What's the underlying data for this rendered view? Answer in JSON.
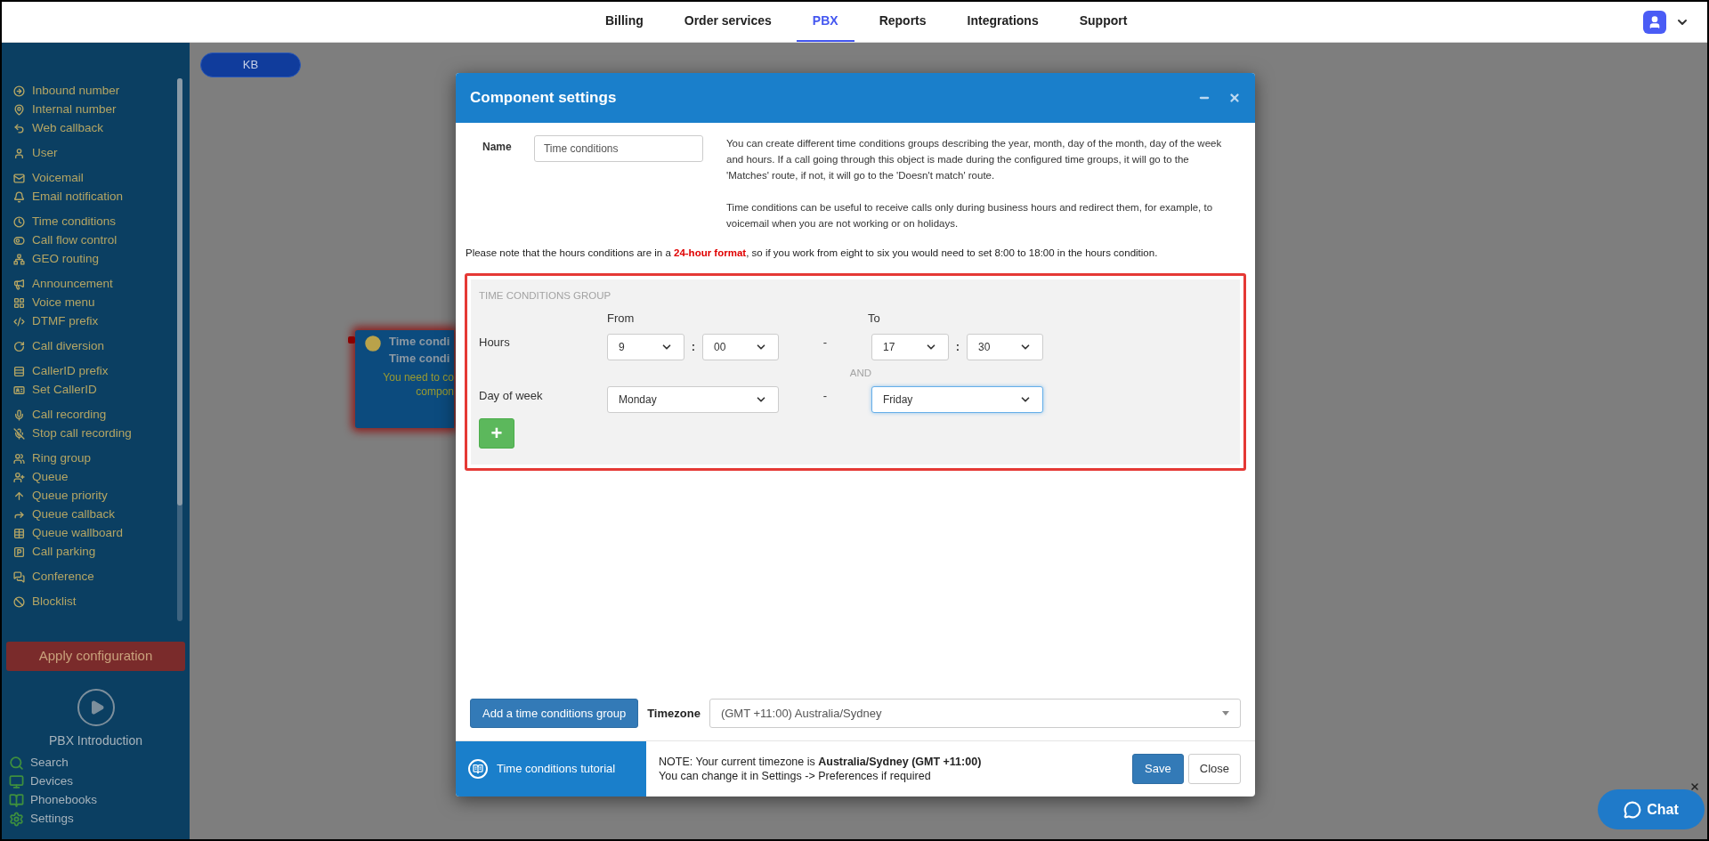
{
  "nav": {
    "tabs": [
      {
        "label": "Billing",
        "selected": false
      },
      {
        "label": "Order services",
        "selected": false
      },
      {
        "label": "PBX",
        "selected": true
      },
      {
        "label": "Reports",
        "selected": false
      },
      {
        "label": "Integrations",
        "selected": false
      },
      {
        "label": "Support",
        "selected": false
      }
    ]
  },
  "sidebar": {
    "groups": [
      {
        "items": [
          {
            "label": "Inbound number"
          },
          {
            "label": "Internal number"
          },
          {
            "label": "Web callback"
          }
        ]
      },
      {
        "items": [
          {
            "label": "User"
          }
        ]
      },
      {
        "items": [
          {
            "label": "Voicemail"
          },
          {
            "label": "Email notification"
          }
        ]
      },
      {
        "items": [
          {
            "label": "Time conditions"
          },
          {
            "label": "Call flow control"
          },
          {
            "label": "GEO routing"
          }
        ]
      },
      {
        "items": [
          {
            "label": "Announcement"
          },
          {
            "label": "Voice menu"
          },
          {
            "label": "DTMF prefix"
          }
        ]
      },
      {
        "items": [
          {
            "label": "Call diversion"
          }
        ]
      },
      {
        "items": [
          {
            "label": "CallerID prefix"
          },
          {
            "label": "Set CallerID"
          }
        ]
      },
      {
        "items": [
          {
            "label": "Call recording"
          },
          {
            "label": "Stop call recording"
          }
        ]
      },
      {
        "items": [
          {
            "label": "Ring group"
          },
          {
            "label": "Queue"
          },
          {
            "label": "Queue priority"
          },
          {
            "label": "Queue callback"
          },
          {
            "label": "Queue wallboard"
          },
          {
            "label": "Call parking"
          }
        ]
      },
      {
        "items": [
          {
            "label": "Conference"
          }
        ]
      },
      {
        "items": [
          {
            "label": "Blocklist"
          }
        ]
      }
    ],
    "apply_button": "Apply configuration",
    "intro_label": "PBX Introduction",
    "tools": [
      {
        "label": "Search"
      },
      {
        "label": "Devices"
      },
      {
        "label": "Phonebooks"
      },
      {
        "label": "Settings"
      }
    ]
  },
  "canvas": {
    "kb_label": "KB",
    "node": {
      "title_lines": [
        "Time condi",
        "Time condi"
      ],
      "message_lines": [
        "You need to co",
        "compon"
      ]
    }
  },
  "modal": {
    "title": "Component settings",
    "name_label": "Name",
    "name_value": "Time conditions",
    "description": [
      "You can create different time conditions groups describing the year, month, day of the month, day of the week and hours. If a call going through this object is made during the configured time groups, it will go to the 'Matches' route, if not, it will go to the 'Doesn't match' route.",
      "Time conditions can be useful to receive calls only during business hours and redirect them, for example, to voicemail when you are not working or on holidays."
    ],
    "note": "Please note that the hours conditions are in a **24-hour format**, so if you work from eight to six you would need to set 8:00 to 18:00 in the hours condition.",
    "group": {
      "heading": "TIME CONDITIONS GROUP",
      "from_label": "From",
      "to_label": "To",
      "hours_label": "Hours",
      "from_hour": {
        "value": "9",
        "focused": false
      },
      "from_minute": {
        "value": "00",
        "focused": false
      },
      "separator": ":",
      "dash": "-",
      "to_hour": {
        "value": "17",
        "focused": false
      },
      "to_minute": {
        "value": "30",
        "focused": false
      },
      "and_label": "AND",
      "day_label": "Day of week",
      "from_day": {
        "value": "Monday",
        "focused": false
      },
      "to_day": {
        "value": "Friday",
        "focused": true
      },
      "add_button": "+"
    },
    "add_group_button": "Add a time conditions group",
    "timezone_label": "Timezone",
    "timezone_value": "(GMT +11:00) Australia/Sydney",
    "tutorial_label": "Time conditions tutorial",
    "footer_note": [
      "NOTE: Your current timezone is **Australia/Sydney (GMT +11:00)**",
      "You can change it in Settings -> Preferences if required"
    ],
    "save_button": "Save",
    "close_button": "Close"
  },
  "chat": {
    "label": "Chat"
  }
}
